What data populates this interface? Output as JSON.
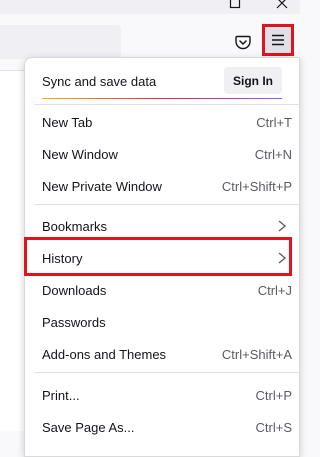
{
  "window": {
    "maximize_icon": "maximize-icon",
    "close_icon": "close-icon"
  },
  "toolbar": {
    "pocket_icon": "pocket-icon",
    "menu_icon": "hamburger-menu-icon",
    "menu_button_highlight_color": "#e0141e"
  },
  "menu": {
    "sync": {
      "label": "Sync and save data",
      "sign_in": "Sign In"
    },
    "items": [
      {
        "label": "New Tab",
        "shortcut": "Ctrl+T"
      },
      {
        "label": "New Window",
        "shortcut": "Ctrl+N"
      },
      {
        "label": "New Private Window",
        "shortcut": "Ctrl+Shift+P"
      },
      {
        "label": "Bookmarks",
        "shortcut": "",
        "submenu_icon": "chevron-right-icon"
      },
      {
        "label": "History",
        "shortcut": "",
        "submenu_icon": "chevron-right-icon",
        "highlighted": true
      },
      {
        "label": "Downloads",
        "shortcut": "Ctrl+J"
      },
      {
        "label": "Passwords",
        "shortcut": ""
      },
      {
        "label": "Add-ons and Themes",
        "shortcut": "Ctrl+Shift+A"
      },
      {
        "label": "Print...",
        "shortcut": "Ctrl+P"
      },
      {
        "label": "Save Page As...",
        "shortcut": "Ctrl+S"
      }
    ]
  }
}
